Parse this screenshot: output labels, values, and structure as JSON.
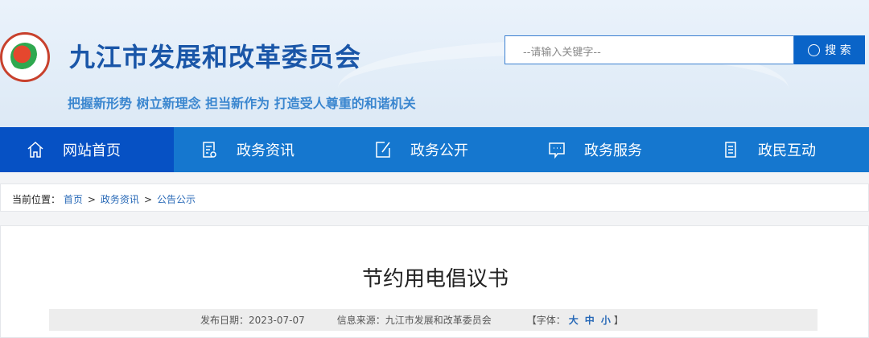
{
  "header": {
    "title": "九江市发展和改革委员会",
    "slogan": "把握新形势 树立新理念 担当新作为 打造受人尊重的和谐机关"
  },
  "search": {
    "placeholder": "--请输入关键字--",
    "button": "搜 索"
  },
  "nav": [
    {
      "label": "网站首页",
      "icon": "home-icon"
    },
    {
      "label": "政务资讯",
      "icon": "news-icon"
    },
    {
      "label": "政务公开",
      "icon": "edit-icon"
    },
    {
      "label": "政务服务",
      "icon": "chat-icon"
    },
    {
      "label": "政民互动",
      "icon": "document-icon"
    }
  ],
  "breadcrumb": {
    "label": "当前位置：",
    "items": [
      "首页",
      "政务资讯",
      "公告公示"
    ],
    "sep": ">"
  },
  "article": {
    "title": "节约用电倡议书",
    "date": "发布日期：2023-07-07",
    "source": "信息来源：九江市发展和改革委员会",
    "font_label": "【字体：",
    "font_large": "大",
    "font_medium": "中",
    "font_small": "小",
    "font_close": "】"
  }
}
